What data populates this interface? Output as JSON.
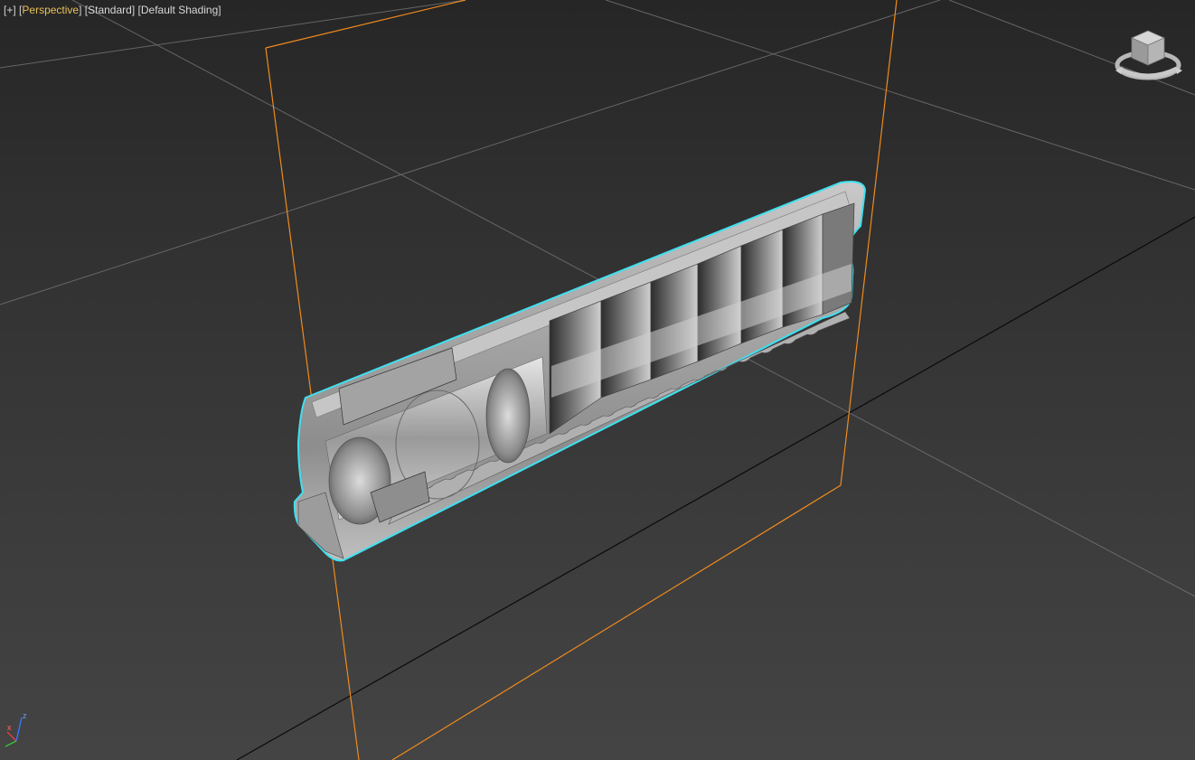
{
  "viewport": {
    "labels": {
      "plus": "+",
      "view": "Perspective",
      "style": "Standard",
      "shading": "Default Shading"
    },
    "colors": {
      "active_label": "#e8c15a",
      "label": "#d8d8d8",
      "selection_outline": "#3fe0f0",
      "section_plane": "#f08a1e",
      "grid": "#7a7a7a",
      "grid_main": "#0a0a0a"
    },
    "viewcube": {
      "icon": "viewcube-icon"
    },
    "axis_tripod": {
      "icon": "axis-tripod-icon",
      "x_label": "x",
      "z_label": "z"
    }
  },
  "scene": {
    "objects": [
      {
        "name": "section-plane",
        "type": "section_plane",
        "color": "#f08a1e"
      },
      {
        "name": "suppressor-cutaway",
        "type": "mesh",
        "selected": true,
        "outline_color": "#3fe0f0"
      }
    ]
  }
}
